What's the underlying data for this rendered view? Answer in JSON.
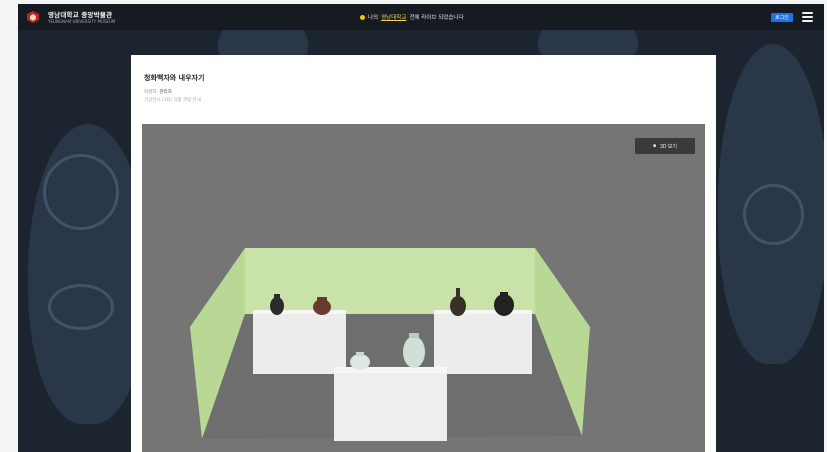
{
  "header": {
    "logo_title": "영남대학교 중앙박물관",
    "logo_sub": "YEUNGNAM UNIVERSITY MUSEUM",
    "notice_prefix": "나의",
    "notice_link": "영남대학교",
    "notice_suffix": "전에 라이브 되었습니다",
    "login_label": "로그인"
  },
  "content": {
    "title": "청화백자와 내우자기",
    "meta_label": "작성자",
    "meta_value": "관리자",
    "description": "가상전시 (3D) 작품 관람 안내"
  },
  "viewer": {
    "view3d_label": "3D 보기",
    "background_color": "#757575",
    "wall_color": "#c8e2a7",
    "pedestal_color": "#efefef"
  },
  "colors": {
    "topbar": "#161b22",
    "login_button": "#1e73e8",
    "notice_dot": "#f1c40f"
  }
}
